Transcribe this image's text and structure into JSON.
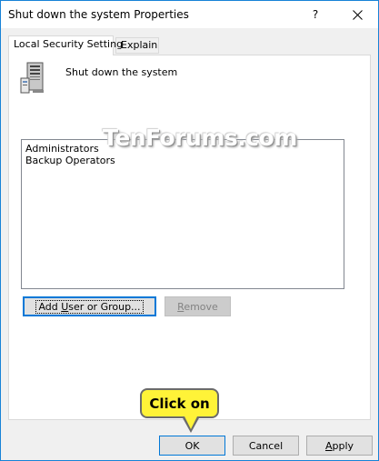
{
  "window": {
    "title": "Shut down the system Properties",
    "help_glyph": "?",
    "close_icon": "close-icon",
    "accent_color": "#1883d7"
  },
  "tabs": [
    {
      "label": "Local Security Setting",
      "active": true
    },
    {
      "label": "Explain",
      "active": false
    }
  ],
  "policy": {
    "name": "Shut down the system",
    "icon": "server-icon"
  },
  "members": [
    "Administrators",
    "Backup Operators"
  ],
  "watermark": "TenForums.com",
  "buttons": {
    "add_prefix": "Add ",
    "add_mnemonic": "U",
    "add_suffix": "ser or Group...",
    "remove_mnemonic": "R",
    "remove_suffix": "emove",
    "ok": "OK",
    "cancel": "Cancel",
    "apply_mnemonic": "A",
    "apply_suffix": "pply"
  },
  "callout": {
    "text": "Click on",
    "color": "#fff338"
  }
}
